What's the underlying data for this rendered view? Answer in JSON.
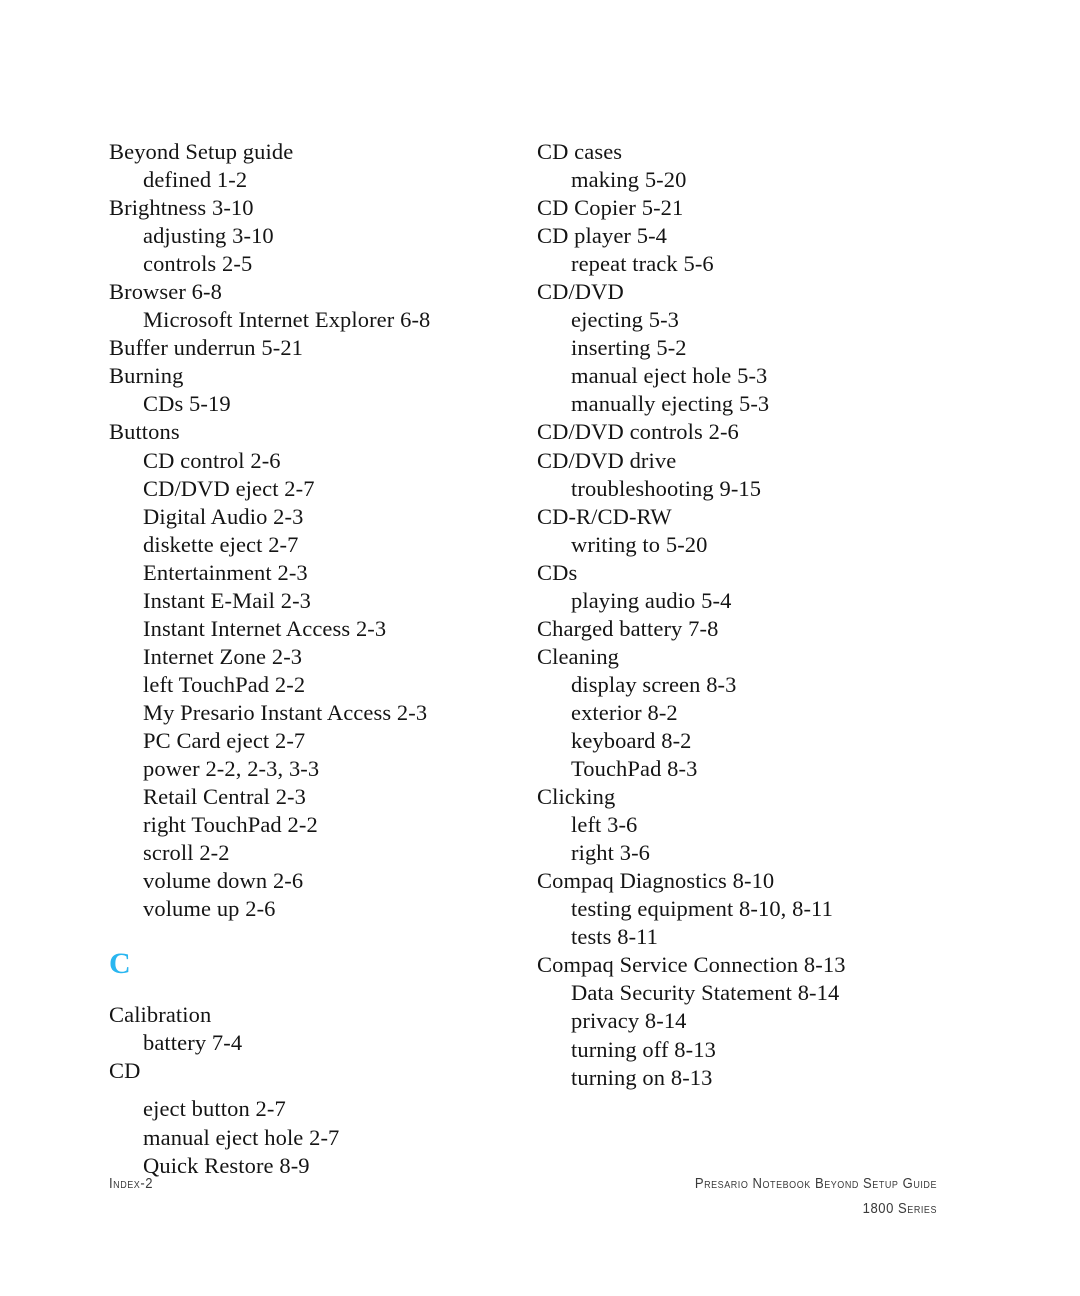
{
  "document": {
    "type": "index-page",
    "colors": {
      "page_background": "#ffffff",
      "body_text": "#141414",
      "section_letter": "#29b6f0",
      "footer_text": "#3a3a3a"
    }
  },
  "columns": {
    "left": [
      {
        "level": "main",
        "text": "Beyond Setup guide"
      },
      {
        "level": "sub",
        "text": "defined 1-2"
      },
      {
        "level": "main",
        "text": "Brightness 3-10"
      },
      {
        "level": "sub",
        "text": "adjusting 3-10"
      },
      {
        "level": "sub",
        "text": "controls 2-5"
      },
      {
        "level": "main",
        "text": "Browser 6-8"
      },
      {
        "level": "sub",
        "text": "Microsoft Internet Explorer 6-8"
      },
      {
        "level": "main",
        "text": "Buffer underrun 5-21"
      },
      {
        "level": "main",
        "text": "Burning"
      },
      {
        "level": "sub",
        "text": "CDs 5-19"
      },
      {
        "level": "main",
        "text": "Buttons"
      },
      {
        "level": "sub",
        "text": "CD control 2-6"
      },
      {
        "level": "sub",
        "text": "CD/DVD eject 2-7"
      },
      {
        "level": "sub",
        "text": "Digital Audio 2-3"
      },
      {
        "level": "sub",
        "text": "diskette eject 2-7"
      },
      {
        "level": "sub",
        "text": "Entertainment 2-3"
      },
      {
        "level": "sub",
        "text": "Instant E-Mail 2-3"
      },
      {
        "level": "sub",
        "text": "Instant Internet Access 2-3"
      },
      {
        "level": "sub",
        "text": "Internet Zone 2-3"
      },
      {
        "level": "sub",
        "text": "left TouchPad 2-2"
      },
      {
        "level": "sub",
        "text": "My Presario Instant Access 2-3"
      },
      {
        "level": "sub",
        "text": "PC Card eject 2-7"
      },
      {
        "level": "sub",
        "text": "power 2-2, 2-3, 3-3"
      },
      {
        "level": "sub",
        "text": "Retail Central 2-3"
      },
      {
        "level": "sub",
        "text": "right TouchPad 2-2"
      },
      {
        "level": "sub",
        "text": "scroll 2-2"
      },
      {
        "level": "sub",
        "text": "volume down 2-6"
      },
      {
        "level": "sub",
        "text": "volume up 2-6"
      }
    ],
    "section_letter": "C",
    "left_after_letter": [
      {
        "level": "main",
        "text": "Calibration"
      },
      {
        "level": "sub",
        "text": "battery 7-4"
      },
      {
        "level": "main",
        "text": "CD"
      },
      {
        "level": "sub",
        "text": "eject button 2-7",
        "gap_before": true
      },
      {
        "level": "sub",
        "text": "manual eject hole 2-7"
      },
      {
        "level": "sub",
        "text": "Quick Restore 8-9"
      }
    ],
    "right": [
      {
        "level": "main",
        "text": "CD cases"
      },
      {
        "level": "sub",
        "text": "making 5-20"
      },
      {
        "level": "main",
        "text": "CD Copier 5-21"
      },
      {
        "level": "main",
        "text": "CD player 5-4"
      },
      {
        "level": "sub",
        "text": "repeat track 5-6"
      },
      {
        "level": "main",
        "text": "CD/DVD"
      },
      {
        "level": "sub",
        "text": "ejecting 5-3"
      },
      {
        "level": "sub",
        "text": "inserting 5-2"
      },
      {
        "level": "sub",
        "text": "manual eject hole 5-3"
      },
      {
        "level": "sub",
        "text": "manually ejecting 5-3"
      },
      {
        "level": "main",
        "text": "CD/DVD controls 2-6"
      },
      {
        "level": "main",
        "text": "CD/DVD drive"
      },
      {
        "level": "sub",
        "text": "troubleshooting 9-15"
      },
      {
        "level": "main",
        "text": "CD-R/CD-RW"
      },
      {
        "level": "sub",
        "text": "writing to 5-20"
      },
      {
        "level": "main",
        "text": "CDs"
      },
      {
        "level": "sub",
        "text": "playing audio 5-4"
      },
      {
        "level": "main",
        "text": "Charged battery 7-8"
      },
      {
        "level": "main",
        "text": "Cleaning"
      },
      {
        "level": "sub",
        "text": "display screen 8-3"
      },
      {
        "level": "sub",
        "text": "exterior 8-2"
      },
      {
        "level": "sub",
        "text": "keyboard 8-2"
      },
      {
        "level": "sub",
        "text": "TouchPad 8-3"
      },
      {
        "level": "main",
        "text": "Clicking"
      },
      {
        "level": "sub",
        "text": "left 3-6"
      },
      {
        "level": "sub",
        "text": "right 3-6"
      },
      {
        "level": "main",
        "text": "Compaq Diagnostics 8-10"
      },
      {
        "level": "sub",
        "text": "testing equipment 8-10, 8-11"
      },
      {
        "level": "sub",
        "text": "tests 8-11"
      },
      {
        "level": "main",
        "text": "Compaq Service Connection 8-13"
      },
      {
        "level": "sub",
        "text": "Data Security Statement 8-14"
      },
      {
        "level": "sub",
        "text": "privacy 8-14"
      },
      {
        "level": "sub",
        "text": "turning off 8-13"
      },
      {
        "level": "sub",
        "text": "turning on 8-13"
      }
    ]
  },
  "footer": {
    "page_label": "Index-2",
    "guide_title": "Presario Notebook Beyond Setup Guide",
    "series": "1800 Series"
  }
}
